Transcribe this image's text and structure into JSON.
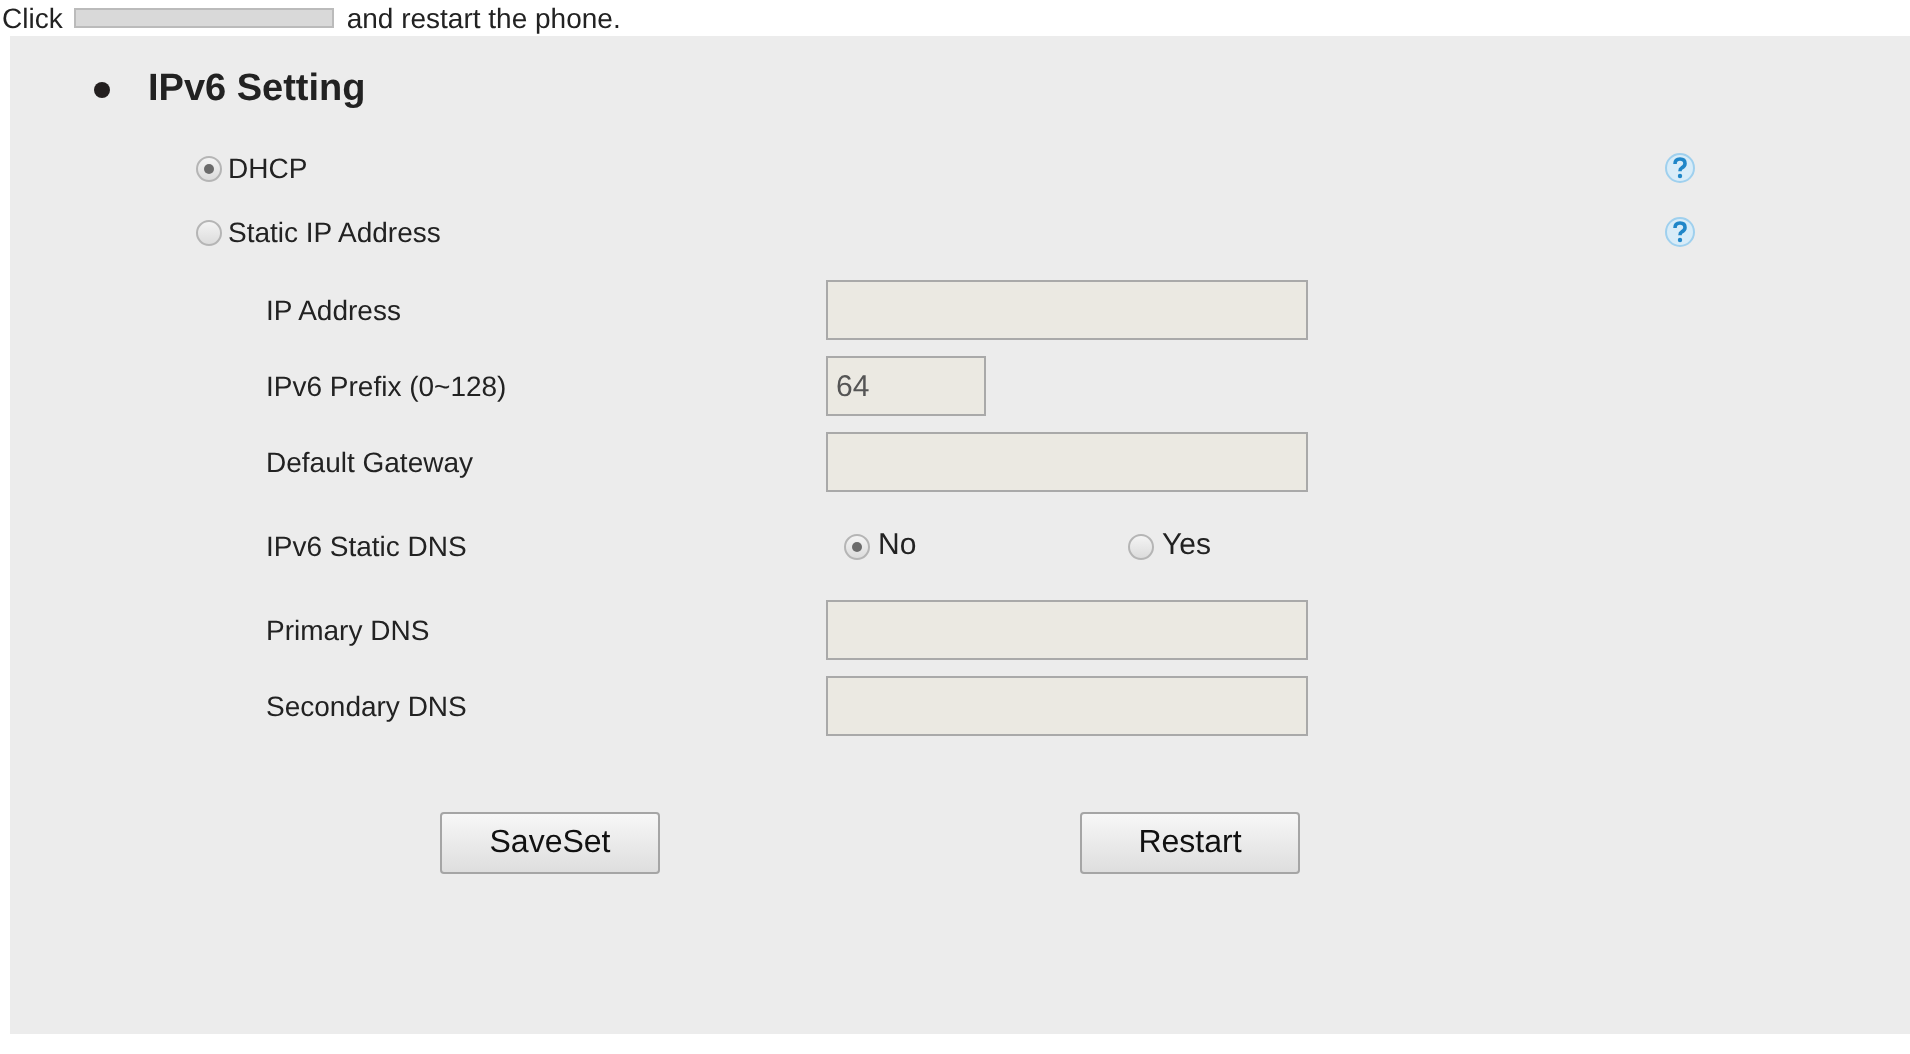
{
  "intro": {
    "before": "Click",
    "after": "and restart the phone."
  },
  "section": {
    "title": "IPv6 Setting"
  },
  "modes": [
    {
      "label": "DHCP",
      "selected": true
    },
    {
      "label": "Static IP Address",
      "selected": false
    }
  ],
  "fields": [
    {
      "kind": "text",
      "label": "IP Address"
    },
    {
      "kind": "short",
      "label": "IPv6 Prefix (0~128)",
      "value": "64"
    },
    {
      "kind": "text",
      "label": "Default Gateway"
    },
    {
      "kind": "radio",
      "label": "IPv6 Static DNS",
      "options": [
        {
          "label": "No",
          "selected": true
        },
        {
          "label": "Yes",
          "selected": false
        }
      ]
    },
    {
      "kind": "text",
      "label": "Primary DNS"
    },
    {
      "kind": "text",
      "label": "Secondary DNS"
    }
  ],
  "buttons": [
    "SaveSet",
    "Restart"
  ]
}
